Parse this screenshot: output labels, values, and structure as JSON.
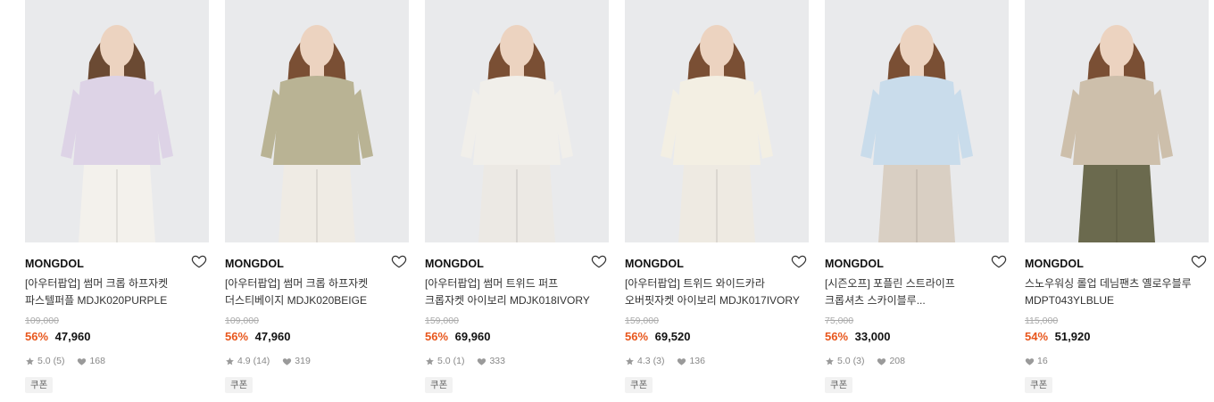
{
  "products": [
    {
      "brand": "MONGDOL",
      "name_line1": "[아우터팝업] 썸머 크롭 하프자켓",
      "name_line2": "파스텔퍼플 MDJK020PURPLE",
      "original_price": "109,000",
      "discount_rate": "56%",
      "sale_price": "47,960",
      "rating": "5.0",
      "review_count": "(5)",
      "likes": "168",
      "coupon": "쿠폰",
      "colors": {
        "jacket": "#ddd3e6",
        "pants": "#f3f1ec",
        "hair": "#6b4a33"
      }
    },
    {
      "brand": "MONGDOL",
      "name_line1": "[아우터팝업] 썸머 크롭 하프자켓",
      "name_line2": "더스티베이지 MDJK020BEIGE",
      "original_price": "109,000",
      "discount_rate": "56%",
      "sale_price": "47,960",
      "rating": "4.9",
      "review_count": "(14)",
      "likes": "319",
      "coupon": "쿠폰",
      "colors": {
        "jacket": "#b9b394",
        "pants": "#efebe4",
        "hair": "#7a4f34"
      }
    },
    {
      "brand": "MONGDOL",
      "name_line1": "[아우터팝업] 썸머 트위드 퍼프",
      "name_line2": "크롭자켓 아이보리 MDJK018IVORY",
      "original_price": "159,000",
      "discount_rate": "56%",
      "sale_price": "69,960",
      "rating": "5.0",
      "review_count": "(1)",
      "likes": "333",
      "coupon": "쿠폰",
      "colors": {
        "jacket": "#f1efea",
        "pants": "#ece9e4",
        "hair": "#7a4f34"
      }
    },
    {
      "brand": "MONGDOL",
      "name_line1": "[아우터팝업] 트위드 와이드카라",
      "name_line2": "오버핏자켓 아이보리 MDJK017IVORY",
      "original_price": "159,000",
      "discount_rate": "56%",
      "sale_price": "69,520",
      "rating": "4.3",
      "review_count": "(3)",
      "likes": "136",
      "coupon": "쿠폰",
      "colors": {
        "jacket": "#f3efe3",
        "pants": "#eeeae2",
        "hair": "#7a4f34"
      }
    },
    {
      "brand": "MONGDOL",
      "name_line1": "[시즌오프] 포플린 스트라이프",
      "name_line2": "크롭셔츠 스카이블루...",
      "original_price": "75,000",
      "discount_rate": "56%",
      "sale_price": "33,000",
      "rating": "5.0",
      "review_count": "(3)",
      "likes": "208",
      "coupon": "쿠폰",
      "colors": {
        "jacket": "#c9dceb",
        "pants": "#d9cfc3",
        "hair": "#7a4f34"
      }
    },
    {
      "brand": "MONGDOL",
      "name_line1": "스노우워싱 롤업 데님팬츠 옐로우블루",
      "name_line2": "MDPT043YLBLUE",
      "original_price": "115,000",
      "discount_rate": "54%",
      "sale_price": "51,920",
      "rating": "",
      "review_count": "",
      "likes": "16",
      "coupon": "쿠폰",
      "colors": {
        "jacket": "#cdbfab",
        "pants": "#6b6a4e",
        "hair": "#7a4f34"
      }
    }
  ]
}
